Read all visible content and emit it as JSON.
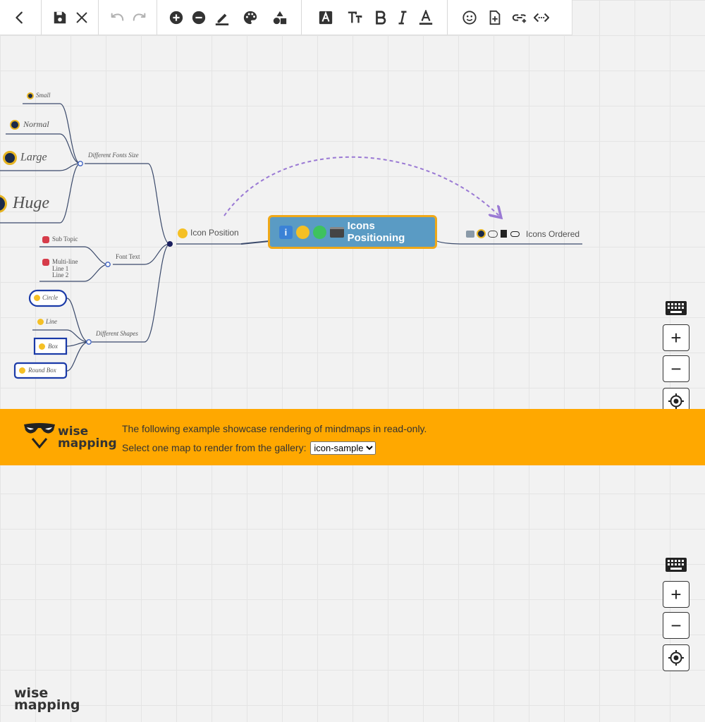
{
  "toolbar": {
    "back_icon": "arrow-left-icon",
    "groups": [
      [
        "save-icon",
        "close-icon"
      ],
      [
        "undo-icon",
        "redo-icon"
      ],
      [
        "add-topic-icon",
        "remove-topic-icon",
        "line-color-icon",
        "palette-icon",
        "shapes-icon"
      ],
      [
        "font-icon",
        "font-size-icon",
        "bold-icon",
        "italic-icon",
        "text-color-icon"
      ],
      [
        "emoji-icon",
        "note-icon",
        "link-icon",
        "embed-icon"
      ]
    ]
  },
  "mindmap": {
    "central": {
      "label": "Icons Positioning",
      "bg": "#5a9bc4",
      "border": "#f0a818"
    },
    "icon_position": {
      "label": "Icon Position"
    },
    "icons_ordered": {
      "label": "Icons Ordered"
    },
    "different_fonts_size": {
      "label": "Different Fonts Size"
    },
    "font_small": {
      "label": "Small"
    },
    "font_normal": {
      "label": "Normal"
    },
    "font_large": {
      "label": "Large"
    },
    "font_huge": {
      "label": "Huge"
    },
    "font_text": {
      "label": "Font Text"
    },
    "sub_topic": {
      "label": "Sub Topic"
    },
    "multiline": {
      "line1": "Multi-line",
      "line2": "Line 1",
      "line3": "Line 2"
    },
    "different_shapes": {
      "label": "Different Shapes"
    },
    "shape_circle": {
      "label": "Circle"
    },
    "shape_line": {
      "label": "Line"
    },
    "shape_box": {
      "label": "Box"
    },
    "shape_round_box": {
      "label": "Round Box"
    },
    "relationship_color": "#9a79d4",
    "line_color": "#3b4a6b"
  },
  "controls": {
    "keyboard_icon": "keyboard-icon",
    "zoom_in": "+",
    "zoom_out": "−",
    "center_icon": "crosshair-icon"
  },
  "banner": {
    "logo_line1": "wise",
    "logo_line2": "mapping",
    "message": "The following example showcase rendering of mindmaps in read-only.",
    "select_label": "Select one map to render from the gallery:",
    "selected_map": "icon-sample",
    "bg": "#ffa800"
  },
  "footer": {
    "logo_line1": "wise",
    "logo_line2": "mapping"
  }
}
